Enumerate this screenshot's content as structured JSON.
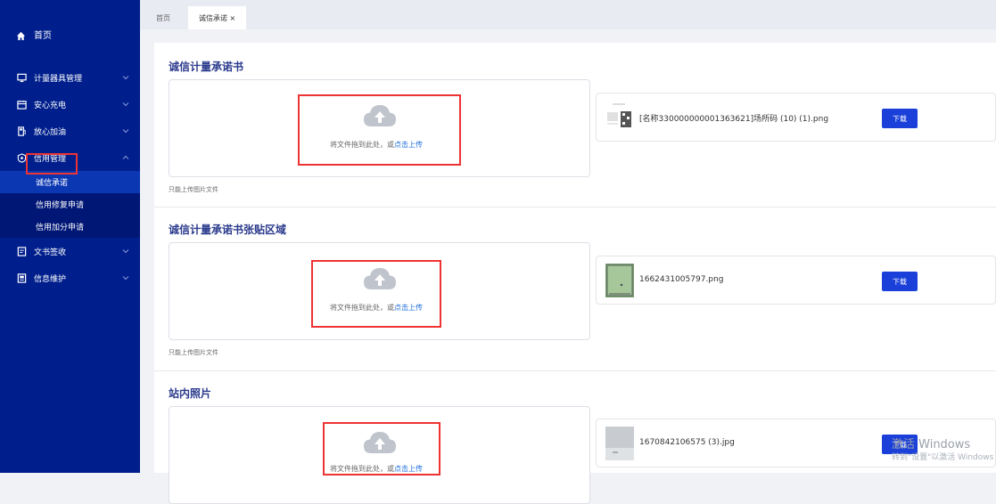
{
  "sidebar": {
    "home": "首页",
    "items": [
      {
        "label": "计量器具管理",
        "icon": "monitor-icon"
      },
      {
        "label": "安心充电",
        "icon": "calendar-icon"
      },
      {
        "label": "放心加油",
        "icon": "fuel-icon"
      },
      {
        "label": "信用管理",
        "icon": "badge-icon"
      }
    ],
    "sub_items": [
      "诚信承诺",
      "信用修复申请",
      "信用加分申请"
    ],
    "items_after": [
      {
        "label": "文书签收",
        "icon": "document-icon"
      },
      {
        "label": "信息维护",
        "icon": "info-icon"
      }
    ]
  },
  "tabs": [
    {
      "label": "首页"
    },
    {
      "label": "诚信承诺 ×"
    }
  ],
  "sections": [
    {
      "title": "诚信计量承诺书",
      "upload_text_prefix": "将文件拖到此处，或",
      "upload_text_link": "点击上传",
      "tip": "只能上传图片文件",
      "file_name": "[名称330000000001363621]场所码 (10) (1).png",
      "download": "下载"
    },
    {
      "title": "诚信计量承诺书张贴区域",
      "upload_text_prefix": "将文件拖到此处，或",
      "upload_text_link": "点击上传",
      "tip": "只能上传图片文件",
      "file_name": "1662431005797.png",
      "download": "下载"
    },
    {
      "title": "站内照片",
      "upload_text_prefix": "将文件拖到此处，或",
      "upload_text_link": "点击上传",
      "file_name": "1670842106575 (3).jpg",
      "download": "下载"
    }
  ],
  "watermark": {
    "line1": "激活 Windows",
    "line2": "转到\"设置\"以激活 Windows"
  },
  "colors": {
    "sidebar": "#001f8c",
    "accent": "#1a40d9",
    "highlight": "#e33333"
  }
}
